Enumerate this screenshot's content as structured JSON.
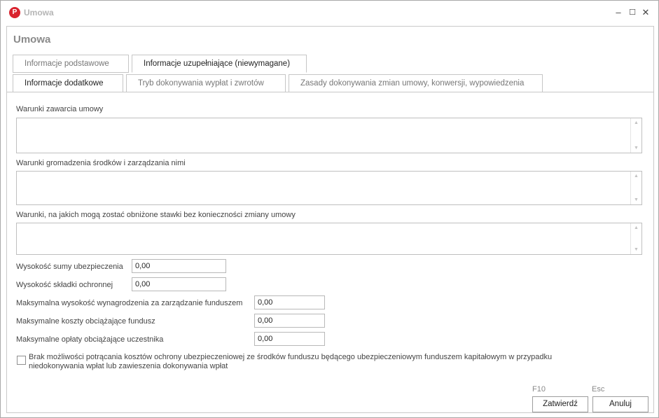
{
  "window": {
    "title": "Umowa",
    "logo_letter": "P"
  },
  "window_controls": {
    "minimize": "–",
    "maximize": "☐",
    "close": "✕"
  },
  "page": {
    "title": "Umowa"
  },
  "tabs_top": [
    {
      "label": "Informacje podstawowe"
    },
    {
      "label": "Informacje uzupełniające (niewymagane)"
    }
  ],
  "tabs_sub": [
    {
      "label": "Informacje dodatkowe"
    },
    {
      "label": "Tryb dokonywania wypłat i zwrotów"
    },
    {
      "label": "Zasady dokonywania zmian umowy, konwersji, wypowiedzenia"
    }
  ],
  "textareas": [
    {
      "label": "Warunki zawarcia umowy",
      "value": ""
    },
    {
      "label": "Warunki gromadzenia środków i zarządzania nimi",
      "value": ""
    },
    {
      "label": "Warunki, na jakich mogą zostać obniżone stawki bez konieczności zmiany umowy",
      "value": ""
    }
  ],
  "fields": [
    {
      "label": "Wysokość sumy ubezpieczenia",
      "value": "0,00"
    },
    {
      "label": "Wysokość składki ochronnej",
      "value": "0,00"
    },
    {
      "label": "Maksymalna wysokość wynagrodzenia za zarządzanie funduszem",
      "value": "0,00"
    },
    {
      "label": "Maksymalne koszty obciążające fundusz",
      "value": "0,00"
    },
    {
      "label": "Maksymalne opłaty obciążające uczestnika",
      "value": "0,00"
    }
  ],
  "checkbox": {
    "line1": "Brak możliwości potrącania kosztów ochrony ubezpieczeniowej ze środków funduszu będącego ubezpieczeniowym funduszem kapitałowym w przypadku",
    "line2": "niedokonywania wpłat lub zawieszenia dokonywania wpłat"
  },
  "buttons": {
    "confirm": {
      "label": "Zatwierdź",
      "hotkey": "F10"
    },
    "cancel": {
      "label": "Anuluj",
      "hotkey": "Esc"
    }
  }
}
